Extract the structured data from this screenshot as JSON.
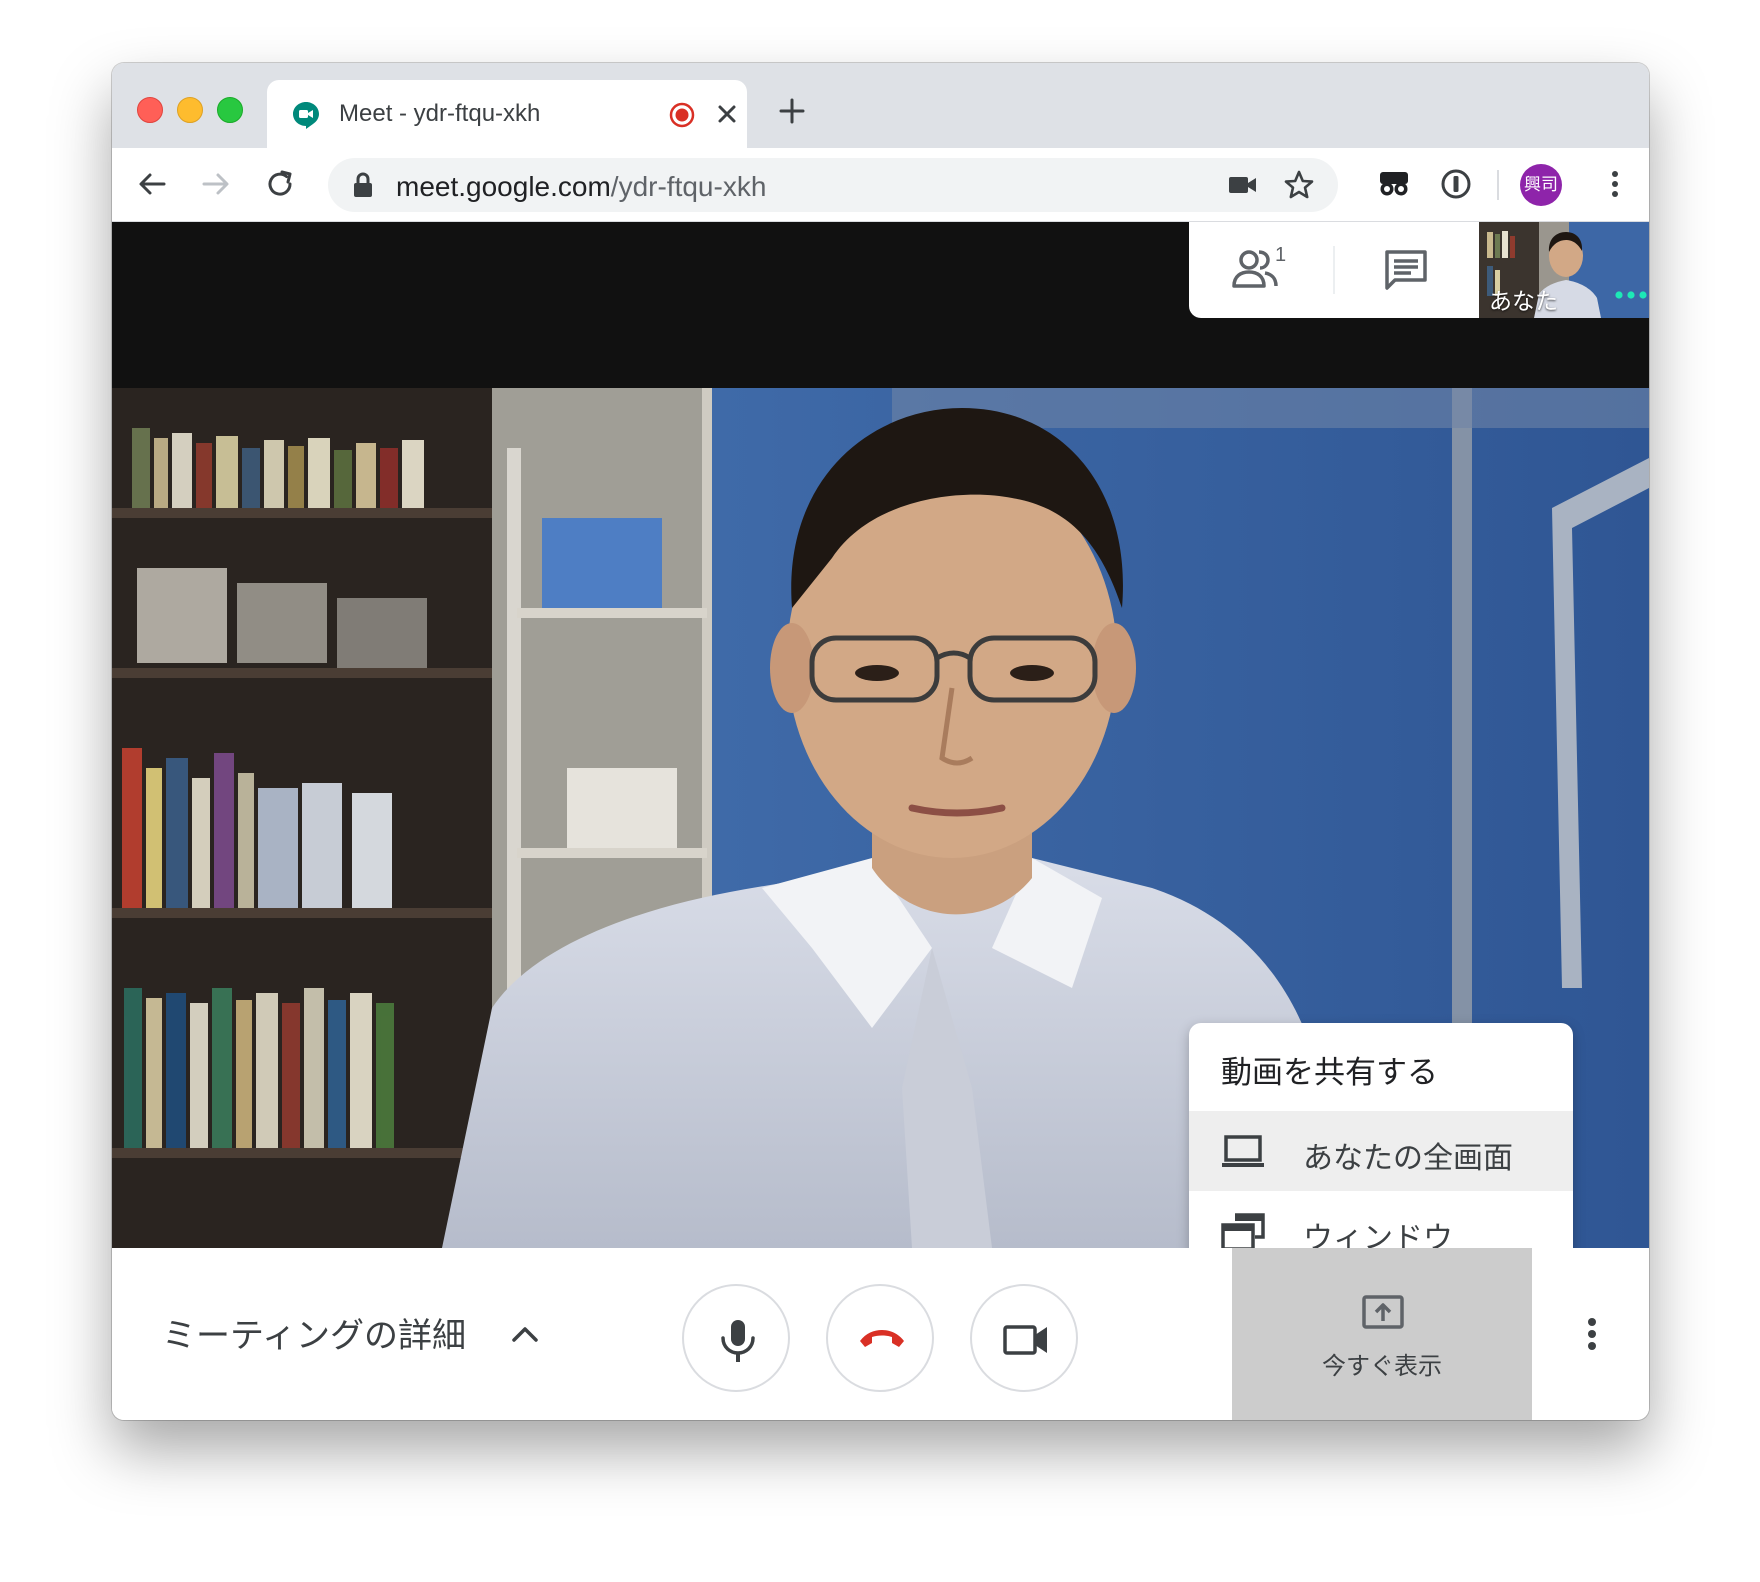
{
  "browser": {
    "tab": {
      "title": "Meet - ydr-ftqu-xkh",
      "recording_icon": "recording-dot-icon",
      "close_icon": "close-icon"
    },
    "new_tab_icon": "plus-icon",
    "nav": {
      "back_icon": "arrow-left-icon",
      "forward_icon": "arrow-right-icon",
      "reload_icon": "reload-icon"
    },
    "address": {
      "lock_icon": "lock-icon",
      "host": "meet.google.com",
      "path": "/ydr-ftqu-xkh"
    },
    "toolbar_icons": [
      "camera-icon",
      "star-icon",
      "extension-glasses-icon",
      "extension-info-icon",
      "more-vertical-icon"
    ],
    "profile_avatar_text": "興司"
  },
  "meet": {
    "top_panel": {
      "people_icon": "people-icon",
      "people_count": "1",
      "chat_icon": "chat-icon"
    },
    "self_view": {
      "label": "あなた",
      "more_icon": "more-horizontal-icon"
    },
    "share_menu": {
      "title": "動画を共有する",
      "items": [
        {
          "icon": "laptop-icon",
          "label": "あなたの全画面",
          "highlighted": true
        },
        {
          "icon": "windows-icon",
          "label": "ウィンドウ",
          "highlighted": false
        }
      ]
    },
    "bottom_bar": {
      "meeting_details_label": "ミーティングの詳細",
      "meeting_details_icon": "chevron-up-icon",
      "mic_icon": "microphone-icon",
      "hangup_icon": "hang-up-icon",
      "camera_icon": "video-camera-icon",
      "present_now_label": "今すぐ表示",
      "present_now_icon": "present-screen-icon",
      "more_icon": "more-vertical-icon"
    }
  },
  "colors": {
    "hangup_red": "#d93025",
    "avatar_purple": "#8e24aa",
    "meet_bg": "#111111",
    "present_bg": "#cccccc"
  }
}
